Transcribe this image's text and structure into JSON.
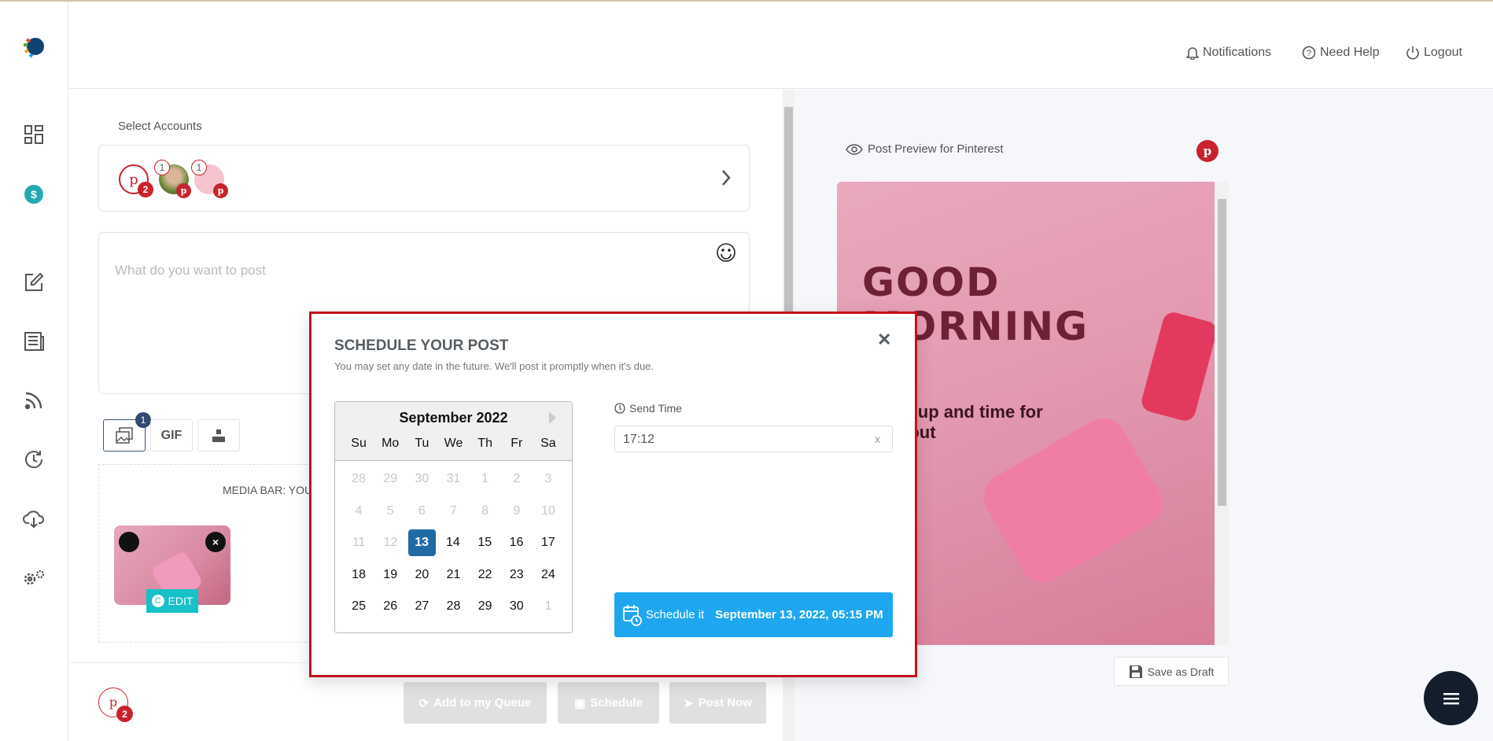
{
  "header": {
    "nav": [
      {
        "label": "Notifications",
        "icon": "bell-icon"
      },
      {
        "label": "Need Help",
        "icon": "help-circle-icon"
      },
      {
        "label": "Logout",
        "icon": "power-icon"
      }
    ]
  },
  "sidebar": {
    "items": [
      "dashboard-icon",
      "billing-icon",
      "compose-icon",
      "posts-icon",
      "rss-icon",
      "recycle-icon",
      "cloud-download-icon",
      "settings-icon"
    ]
  },
  "composer": {
    "select_accounts_label": "Select Accounts",
    "accounts": [
      {
        "badge": "2"
      },
      {
        "badge": "1"
      },
      {
        "badge": "1"
      }
    ],
    "placeholder": "What do you want to post",
    "media_count": "1",
    "gif_label": "GIF",
    "media_bar_text": "MEDIA BAR: YOU",
    "edit_label": "EDIT",
    "footer_pin_badge": "2",
    "actions": {
      "queue": "Add to my Queue",
      "schedule": "Schedule",
      "post_now": "Post Now"
    }
  },
  "modal": {
    "title": "SCHEDULE YOUR POST",
    "subtitle": "You may set any date in the future. We'll post it promptly when it's due.",
    "calendar": {
      "month": "September 2022",
      "day_names": [
        "Su",
        "Mo",
        "Tu",
        "We",
        "Th",
        "Fr",
        "Sa"
      ],
      "weeks": [
        [
          "28",
          "29",
          "30",
          "31",
          "1",
          "2",
          "3"
        ],
        [
          "4",
          "5",
          "6",
          "7",
          "8",
          "9",
          "10"
        ],
        [
          "11",
          "12",
          "13",
          "14",
          "15",
          "16",
          "17"
        ],
        [
          "18",
          "19",
          "20",
          "21",
          "22",
          "23",
          "24"
        ],
        [
          "25",
          "26",
          "27",
          "28",
          "29",
          "30",
          "1"
        ]
      ],
      "disabled_until": "12",
      "selected": "13"
    },
    "send_time_label": "Send Time",
    "send_time_value": "17:12",
    "clear_label": "x",
    "schedule_button": "Schedule it",
    "schedule_datetime": "September 13, 2022, 05:15 PM"
  },
  "preview": {
    "title": "Post Preview for Pinterest",
    "image_text": {
      "headline": "GOOD MORNING",
      "subline": "Wake up and time for workout"
    },
    "save_draft": "Save as Draft"
  },
  "colors": {
    "pinterest": "#c8232c",
    "accent": "#1ea7f0",
    "selected_day": "#1f6aa5",
    "modal_border": "#c1121c",
    "edit": "#16c1c8"
  }
}
